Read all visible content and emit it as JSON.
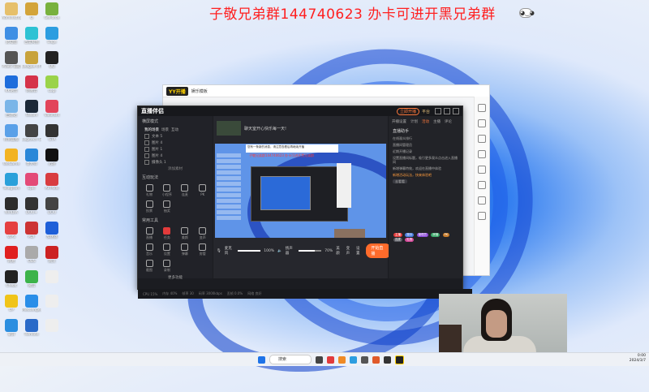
{
  "banner": {
    "text": "子敬兄弟群144740623 办卡可进开黑兄弟群"
  },
  "desktop_icons": [
    {
      "label": "Administrator",
      "color": "#e6c06b"
    },
    {
      "label": "Q",
      "color": "#d3a43a"
    },
    {
      "label": "GeForce",
      "color": "#78b13d"
    },
    {
      "label": "此电脑",
      "color": "#3f8fe4"
    },
    {
      "label": "百度网盘",
      "color": "#2dc2d4"
    },
    {
      "label": "Edge",
      "color": "#2c9de0"
    },
    {
      "label": "PUBG 辅助",
      "color": "#555"
    },
    {
      "label": "League of Legends",
      "color": "#c8a33c"
    },
    {
      "label": "QQ",
      "color": "#222"
    },
    {
      "label": "KK语音",
      "color": "#1e6ddc"
    },
    {
      "label": "网易云",
      "color": "#d5334a"
    },
    {
      "label": "Logi",
      "color": "#9ad34a"
    },
    {
      "label": "回收站",
      "color": "#7ab5e8"
    },
    {
      "label": "Steam",
      "color": "#1b2838"
    },
    {
      "label": "Valorant",
      "color": "#e2455b"
    },
    {
      "label": "控制面板",
      "color": "#5aa0e8"
    },
    {
      "label": "Logitech G HUB",
      "color": "#444"
    },
    {
      "label": "GTA",
      "color": "#333"
    },
    {
      "label": "WeGame",
      "color": "#f2b323"
    },
    {
      "label": "鲁大师",
      "color": "#2a87d8"
    },
    {
      "label": "迅游",
      "color": "#111"
    },
    {
      "label": "Telegram",
      "color": "#2aa0da"
    },
    {
      "label": "Epic",
      "color": "#e34a78"
    },
    {
      "label": "AirPods",
      "color": "#d83c40"
    },
    {
      "label": "NVIDIA",
      "color": "#2d2d2d"
    },
    {
      "label": "DOU+",
      "color": "#333"
    },
    {
      "label": "DOU",
      "color": "#444"
    },
    {
      "label": "WPS",
      "color": "#e54040"
    },
    {
      "label": "PDF",
      "color": "#c33"
    },
    {
      "label": "加速器",
      "color": "#1e5fd8"
    },
    {
      "label": "网易",
      "color": "#e02020"
    },
    {
      "label": "OBS",
      "color": "#aaa"
    },
    {
      "label": "网页",
      "color": "#c22"
    },
    {
      "label": "Cheat",
      "color": "#222"
    },
    {
      "label": "微信",
      "color": "#3cb34a"
    },
    {
      "label": "",
      "color": "#eee"
    },
    {
      "label": "OP",
      "color": "#f0c419"
    },
    {
      "label": "Messenger",
      "color": "#2a8ee8"
    },
    {
      "label": "",
      "color": "#eee"
    },
    {
      "label": "录屏",
      "color": "#2b8ee0"
    },
    {
      "label": "Remote",
      "color": "#2a6ac8"
    },
    {
      "label": "",
      "color": "#eee"
    }
  ],
  "yy": {
    "logo": "YY开播",
    "title": "娱乐模板",
    "nav": [
      "开播"
    ]
  },
  "app": {
    "title": "直播伴侣",
    "title_btn": "立即开播",
    "title_btn2": "平台",
    "left": {
      "mode": "横屏模式",
      "tabs": [
        "我的场景",
        "场景",
        "互动"
      ],
      "scenes": [
        "文本 5",
        "图片 4",
        "图片 1",
        "图片 4",
        "摄像头 1"
      ],
      "add_source": "添加素材",
      "interact_title": "互动玩法",
      "interact_tools": [
        "礼物",
        "小程序",
        "连麦",
        "PK",
        "投票",
        "抽奖"
      ],
      "common_title": "常用工具",
      "common_tools": [
        "直播",
        "任务",
        "美颜",
        "变声",
        "音乐",
        "设置"
      ],
      "common_tools2": [
        "弹幕",
        "房管",
        "截图",
        "录制"
      ],
      "more": "更多功能"
    },
    "center": {
      "topic": "聊天室开心快乐每一天!",
      "notice": "您有一条新的消息，请注意查看后再继续开播",
      "red_text": "子敬兄弟群144740623 办卡可进开黑兄弟群",
      "mic_label": "麦克风",
      "mic_pct": "100%",
      "speaker_label": "扬声器",
      "speaker_pct": "70%",
      "mic_level": 1.0,
      "speaker_level": 0.7,
      "icons": [
        "美颜",
        "变声",
        "设置"
      ],
      "golive": "开始直播"
    },
    "right": {
      "tabs": [
        "开播设置",
        "计划",
        "活动",
        "主播",
        "评论"
      ],
      "title": "直播助手",
      "items": [
        "在线观众排行",
        "直播间管理员",
        "近期开播记录",
        "设置直播间标题，吸引更多观众点击进入直播间",
        "新增弹幕特效，欢迎在直播中体验"
      ],
      "highlight": "新增活动玩法，快来体验吧",
      "highlight2": "去看看",
      "pills": [
        "主播",
        "观众",
        "管理员",
        "房管",
        "PK",
        "连麦",
        "礼物"
      ]
    },
    "status": [
      "CPU 15%",
      "内存 40%",
      "帧率 30",
      "码率 3000kbps",
      "丢帧 0.0%",
      "网络 良好"
    ]
  },
  "taskbar": {
    "search": "搜索",
    "time": "0:00",
    "date": "2024/3/7"
  },
  "colors": {
    "accent": "#ff6b2b",
    "banner": "#ff2020"
  }
}
